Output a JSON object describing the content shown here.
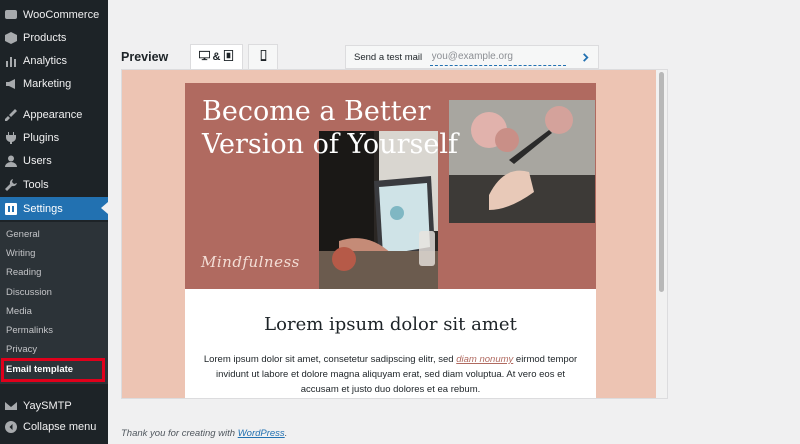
{
  "sidebar": {
    "items": [
      {
        "label": "WooCommerce",
        "icon": "woocommerce-icon"
      },
      {
        "label": "Products",
        "icon": "box-icon"
      },
      {
        "label": "Analytics",
        "icon": "bar-chart-icon"
      },
      {
        "label": "Marketing",
        "icon": "megaphone-icon"
      },
      {
        "label": "Appearance",
        "icon": "paintbrush-icon"
      },
      {
        "label": "Plugins",
        "icon": "plug-icon"
      },
      {
        "label": "Users",
        "icon": "user-icon"
      },
      {
        "label": "Tools",
        "icon": "wrench-icon"
      },
      {
        "label": "Settings",
        "icon": "settings-icon"
      }
    ],
    "submenu": [
      "General",
      "Writing",
      "Reading",
      "Discussion",
      "Media",
      "Permalinks",
      "Privacy",
      "Email template"
    ],
    "bottom_items": [
      {
        "label": "YaySMTP",
        "icon": "mail-icon"
      },
      {
        "label": "Collapse menu",
        "icon": "collapse-icon"
      }
    ],
    "accent_color": "#2271b1"
  },
  "preview": {
    "label": "Preview",
    "tab_desktop_amp": "&",
    "test_mail_label": "Send a test mail",
    "test_mail_placeholder": "you@example.org"
  },
  "email": {
    "hero_title": "Become a Better Version of Yourself",
    "hero_tag": "Mindfulness",
    "heading": "Lorem ipsum dolor sit amet",
    "body_before_link": "Lorem ipsum dolor sit amet, consetetur sadipscing elitr, sed ",
    "body_link": "diam nonumy",
    "body_after_link": " eirmod tempor invidunt ut labore et dolore magna aliquyam erat, sed diam voluptua. At vero eos et accusam et justo duo dolores et ea rebum.",
    "hero_color": "#b06a60",
    "background_color": "#edc4b3"
  },
  "footer": {
    "text": "Thank you for creating with ",
    "link": "WordPress",
    "end": "."
  }
}
